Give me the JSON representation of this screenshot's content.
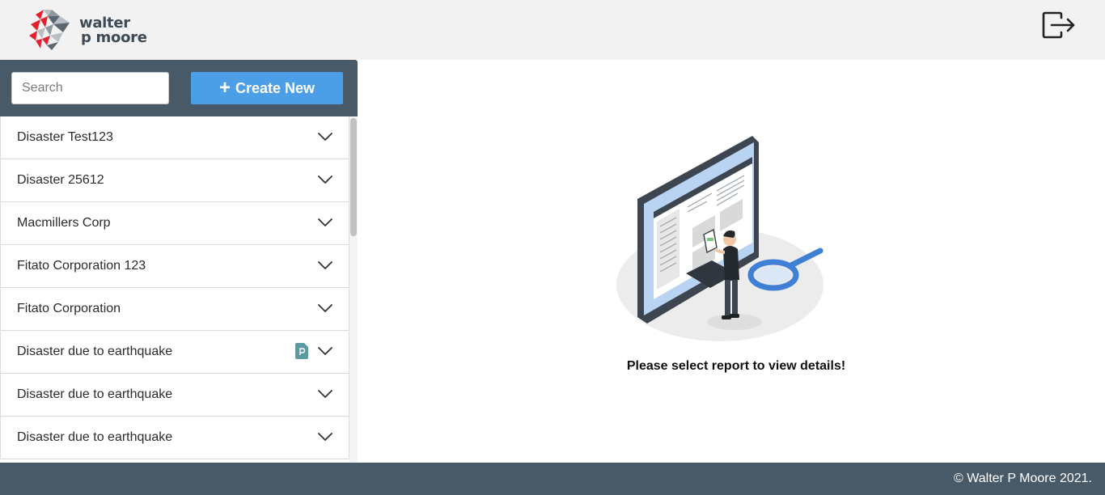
{
  "header": {
    "logo": {
      "line1": "walter",
      "line2": "p moore",
      "colors": {
        "red": "#e4202f",
        "gray": "#5b6770",
        "light": "#b8bec4"
      }
    },
    "logout_icon": "logout-icon"
  },
  "sidebar": {
    "search": {
      "placeholder": "Search",
      "value": ""
    },
    "create_button": {
      "label": "Create New",
      "icon": "plus-icon",
      "color": "#4c9fe6"
    },
    "items": [
      {
        "label": "Disaster Test123",
        "has_pdf": false
      },
      {
        "label": "Disaster 25612",
        "has_pdf": false
      },
      {
        "label": "Macmillers Corp",
        "has_pdf": false
      },
      {
        "label": "Fitato Corporation 123",
        "has_pdf": false
      },
      {
        "label": "Fitato Corporation",
        "has_pdf": false
      },
      {
        "label": "Disaster due to earthquake",
        "has_pdf": true
      },
      {
        "label": "Disaster due to earthquake",
        "has_pdf": false
      },
      {
        "label": "Disaster due to earthquake",
        "has_pdf": false
      }
    ]
  },
  "main": {
    "illustration": "report-review-illustration",
    "message": "Please select report to view details!"
  },
  "footer": {
    "copyright": "© Walter P Moore 2021."
  },
  "theme": {
    "header_bg": "#f2f2f2",
    "dark": "#485a68",
    "accent": "#4c9fe6",
    "pdf_icon": "#5b9aa0"
  }
}
